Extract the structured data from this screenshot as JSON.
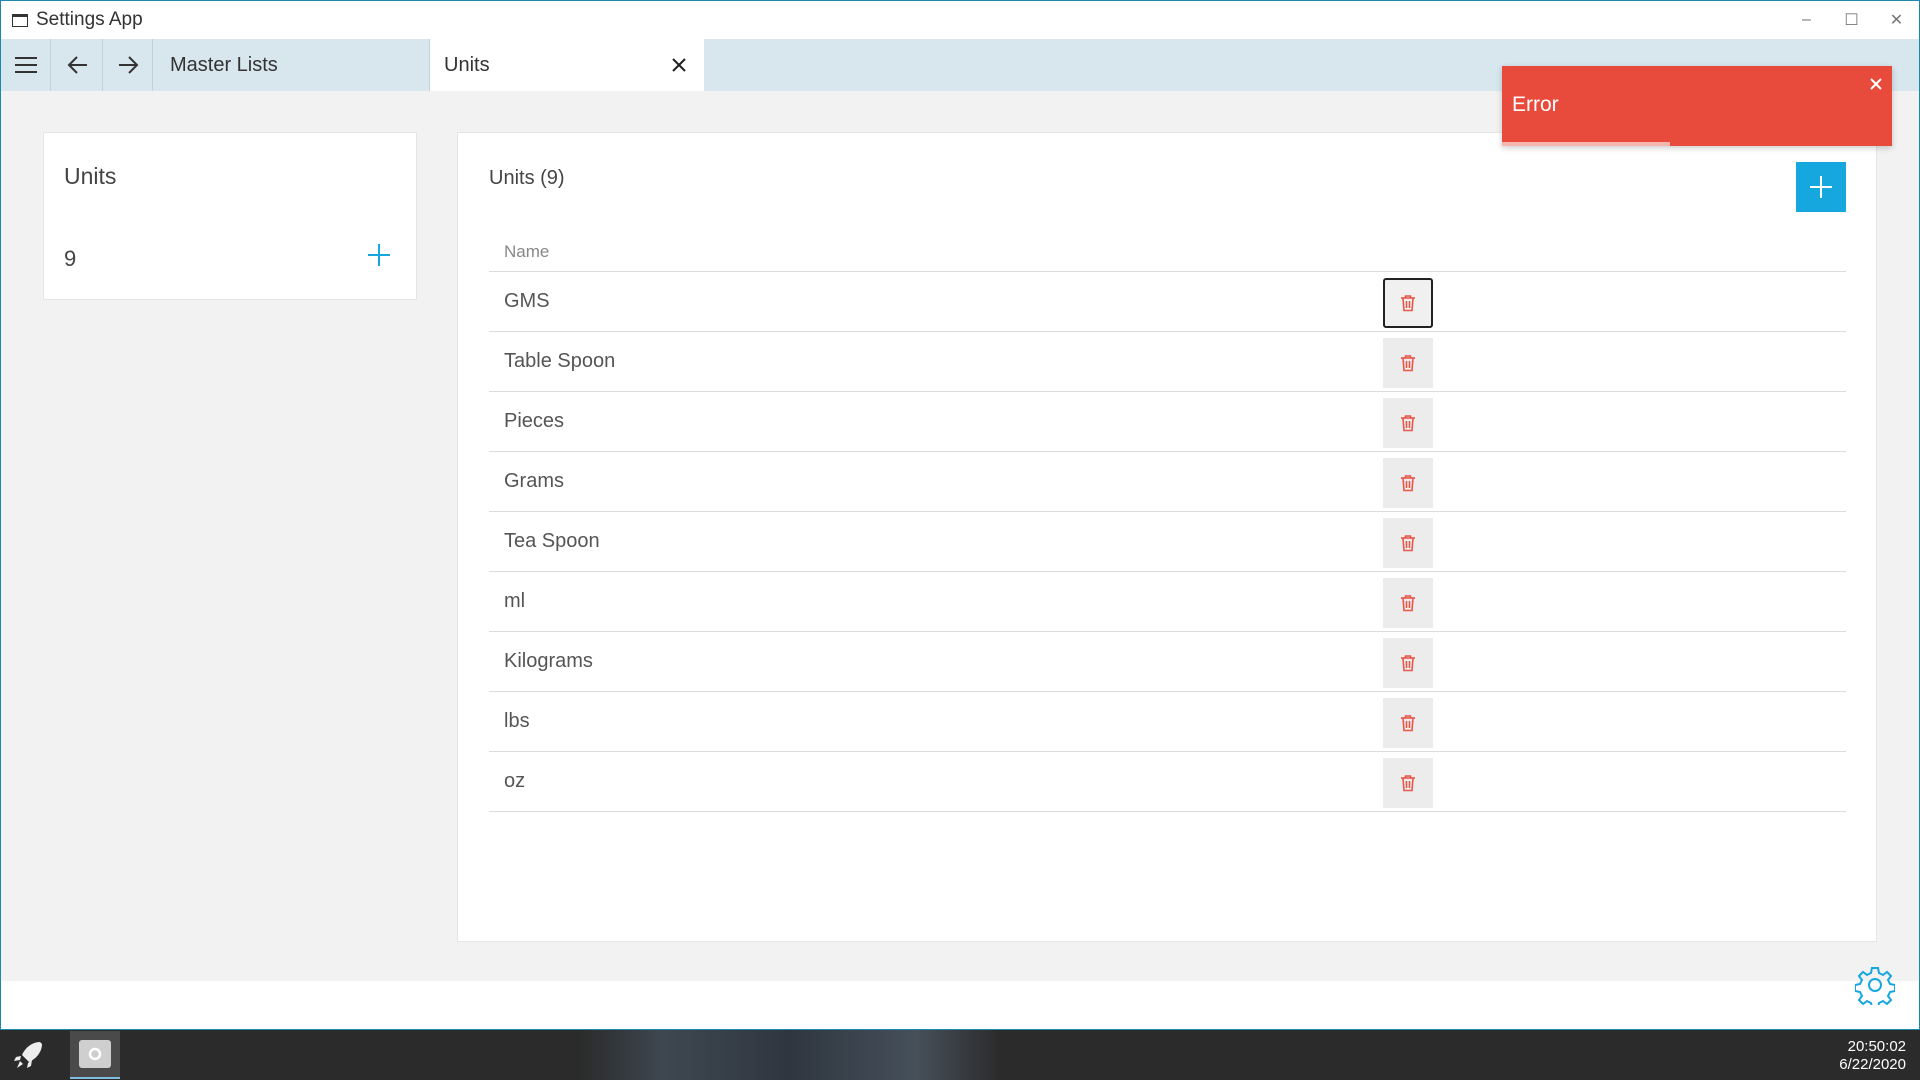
{
  "window": {
    "title": "Settings App",
    "controls": {
      "minimize": "–",
      "maximize": "☐",
      "close": "✕"
    }
  },
  "tabs": [
    {
      "label": "Master Lists"
    },
    {
      "label": "Units"
    }
  ],
  "summary_card": {
    "title": "Units",
    "count": "9"
  },
  "list_card": {
    "title": "Units (9)",
    "column_header": "Name",
    "rows": [
      {
        "name": "GMS"
      },
      {
        "name": "Table Spoon"
      },
      {
        "name": "Pieces"
      },
      {
        "name": "Grams"
      },
      {
        "name": "Tea Spoon"
      },
      {
        "name": "ml"
      },
      {
        "name": "Kilograms"
      },
      {
        "name": "lbs"
      },
      {
        "name": "oz"
      }
    ]
  },
  "toast": {
    "text": "Error",
    "progress": 0.43
  },
  "taskbar": {
    "time": "20:50:02",
    "date": "6/22/2020"
  },
  "colors": {
    "accent": "#16a7de",
    "error": "#e84a3c",
    "delete_icon": "#e8574a",
    "tabbar": "#d8e6ee"
  },
  "icons": [
    "window-icon",
    "hamburger-icon",
    "back-arrow-icon",
    "forward-arrow-icon",
    "close-icon",
    "plus-icon",
    "trash-icon",
    "gear-icon",
    "rocket-icon",
    "settings-app-icon"
  ]
}
